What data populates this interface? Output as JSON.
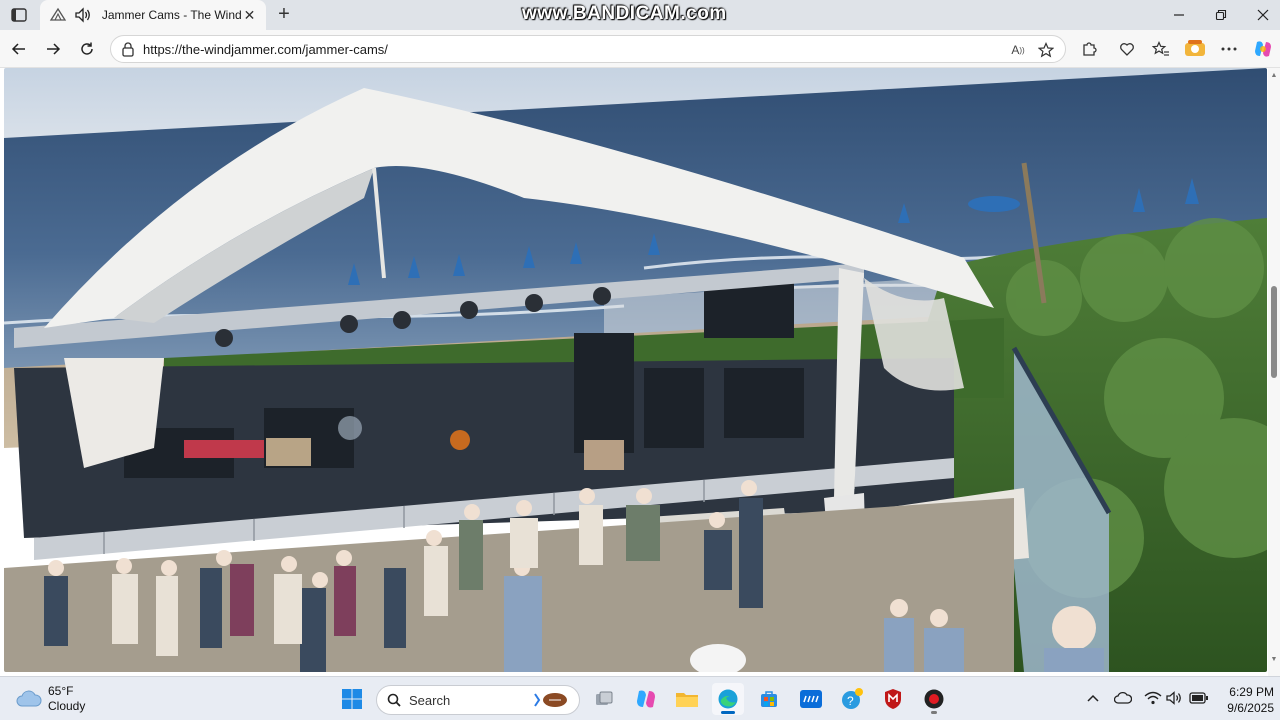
{
  "browser": {
    "tab": {
      "title": "Jammer Cams - The Windjammer",
      "close_label": "✕"
    },
    "new_tab_label": "+",
    "address": {
      "url": "https://the-windjammer.com/jammer-cams/"
    },
    "window_controls": {
      "minimize": "—",
      "maximize": "▢",
      "close": "✕"
    }
  },
  "overlay": {
    "watermark": "www.BANDICAM.com"
  },
  "taskbar": {
    "weather": {
      "temp": "65°F",
      "condition": "Cloudy"
    },
    "search": {
      "placeholder": "Search"
    },
    "clock": {
      "time": "6:29 PM",
      "date": "9/6/2025"
    }
  },
  "colors": {
    "sky": "#c9d6e3",
    "ocean": "#3f5f86",
    "sand": "#c9b79c",
    "dune_green": "#3f6b2f",
    "tent": "#f2f2f0",
    "edge_blue": "#0067c0"
  }
}
